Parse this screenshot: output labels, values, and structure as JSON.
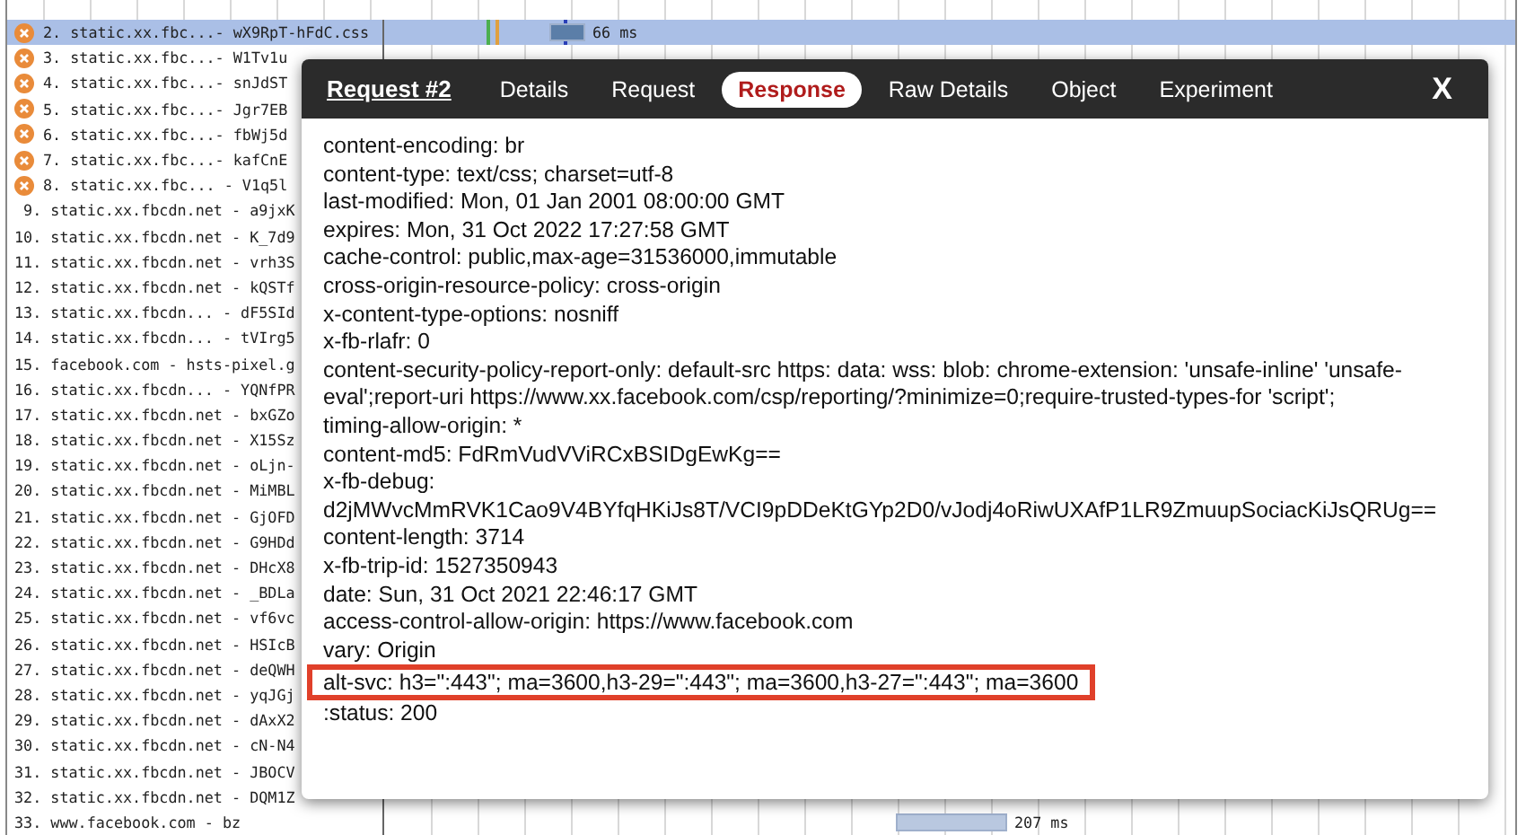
{
  "requests": [
    {
      "label": "2. static.xx.fbc...- wX9RpT-hFdC.css",
      "error": true,
      "selected": true,
      "timing": "66 ms"
    },
    {
      "label": "3. static.xx.fbc...- W1Tv1u",
      "error": true,
      "selected": false
    },
    {
      "label": "4. static.xx.fbc...- snJdST",
      "error": true,
      "selected": false
    },
    {
      "label": "5. static.xx.fbc...- Jgr7EB",
      "error": true,
      "selected": false
    },
    {
      "label": "6. static.xx.fbc...- fbWj5d",
      "error": true,
      "selected": false
    },
    {
      "label": "7. static.xx.fbc...- kafCnE",
      "error": true,
      "selected": false
    },
    {
      "label": "8. static.xx.fbc... - V1q5l",
      "error": true,
      "selected": false
    },
    {
      "label": " 9. static.xx.fbcdn.net - a9jxK",
      "error": false,
      "selected": false
    },
    {
      "label": "10. static.xx.fbcdn.net - K_7d9",
      "error": false,
      "selected": false
    },
    {
      "label": "11. static.xx.fbcdn.net - vrh3S",
      "error": false,
      "selected": false
    },
    {
      "label": "12. static.xx.fbcdn.net - kQSTf",
      "error": false,
      "selected": false
    },
    {
      "label": "13. static.xx.fbcdn... - dF5SId",
      "error": false,
      "selected": false
    },
    {
      "label": "14. static.xx.fbcdn... - tVIrg5",
      "error": false,
      "selected": false
    },
    {
      "label": "15. facebook.com - hsts-pixel.g",
      "error": false,
      "selected": false
    },
    {
      "label": "16. static.xx.fbcdn... - YQNfPR",
      "error": false,
      "selected": false
    },
    {
      "label": "17. static.xx.fbcdn.net - bxGZo",
      "error": false,
      "selected": false
    },
    {
      "label": "18. static.xx.fbcdn.net - X15Sz",
      "error": false,
      "selected": false
    },
    {
      "label": "19. static.xx.fbcdn.net - oLjn-",
      "error": false,
      "selected": false
    },
    {
      "label": "20. static.xx.fbcdn.net - MiMBL",
      "error": false,
      "selected": false
    },
    {
      "label": "21. static.xx.fbcdn.net - GjOFD",
      "error": false,
      "selected": false
    },
    {
      "label": "22. static.xx.fbcdn.net - G9HDd",
      "error": false,
      "selected": false
    },
    {
      "label": "23. static.xx.fbcdn.net - DHcX8",
      "error": false,
      "selected": false
    },
    {
      "label": "24. static.xx.fbcdn.net - _BDLa",
      "error": false,
      "selected": false
    },
    {
      "label": "25. static.xx.fbcdn.net - vf6vc",
      "error": false,
      "selected": false
    },
    {
      "label": "26. static.xx.fbcdn.net - HSIcB",
      "error": false,
      "selected": false
    },
    {
      "label": "27. static.xx.fbcdn.net - deQWH",
      "error": false,
      "selected": false
    },
    {
      "label": "28. static.xx.fbcdn.net - yqJGj",
      "error": false,
      "selected": false
    },
    {
      "label": "29. static.xx.fbcdn.net - dAxX2",
      "error": false,
      "selected": false
    },
    {
      "label": "30. static.xx.fbcdn.net - cN-N4",
      "error": false,
      "selected": false
    },
    {
      "label": "31. static.xx.fbcdn.net - JBOCV",
      "error": false,
      "selected": false
    },
    {
      "label": "32. static.xx.fbcdn.net - DQM1Z",
      "error": false,
      "selected": false
    },
    {
      "label": "33. www.facebook.com - bz",
      "error": false,
      "selected": false,
      "timing": "207 ms"
    }
  ],
  "dialog": {
    "title": "Request #2",
    "tabs": [
      {
        "label": "Details",
        "selected": false
      },
      {
        "label": "Request",
        "selected": false
      },
      {
        "label": "Response",
        "selected": true
      },
      {
        "label": "Raw Details",
        "selected": false
      },
      {
        "label": "Object",
        "selected": false
      },
      {
        "label": "Experiment",
        "selected": false
      }
    ],
    "close": "X",
    "headers": [
      {
        "text": "content-encoding: br",
        "highlighted": false
      },
      {
        "text": "content-type: text/css; charset=utf-8",
        "highlighted": false
      },
      {
        "text": "last-modified: Mon, 01 Jan 2001 08:00:00 GMT",
        "highlighted": false
      },
      {
        "text": "expires: Mon, 31 Oct 2022 17:27:58 GMT",
        "highlighted": false
      },
      {
        "text": "cache-control: public,max-age=31536000,immutable",
        "highlighted": false
      },
      {
        "text": "cross-origin-resource-policy: cross-origin",
        "highlighted": false
      },
      {
        "text": "x-content-type-options: nosniff",
        "highlighted": false
      },
      {
        "text": "x-fb-rlafr: 0",
        "highlighted": false
      },
      {
        "text": "content-security-policy-report-only: default-src https: data: wss: blob: chrome-extension: 'unsafe-inline' 'unsafe-eval';report-uri https://www.xx.facebook.com/csp/reporting/?minimize=0;require-trusted-types-for 'script';",
        "highlighted": false
      },
      {
        "text": "timing-allow-origin: *",
        "highlighted": false
      },
      {
        "text": "content-md5: FdRmVudVViRCxBSIDgEwKg==",
        "highlighted": false
      },
      {
        "text": "x-fb-debug: d2jMWvcMmRVK1Cao9V4BYfqHKiJs8T/VCI9pDDeKtGYp2D0/vJodj4oRiwUXAfP1LR9ZmuupSociacKiJsQRUg==",
        "highlighted": false
      },
      {
        "text": "content-length: 3714",
        "highlighted": false
      },
      {
        "text": "x-fb-trip-id: 1527350943",
        "highlighted": false
      },
      {
        "text": "date: Sun, 31 Oct 2021 22:46:17 GMT",
        "highlighted": false
      },
      {
        "text": "access-control-allow-origin: https://www.facebook.com",
        "highlighted": false
      },
      {
        "text": "vary: Origin",
        "highlighted": false
      },
      {
        "text": "alt-svc: h3=\":443\"; ma=3600,h3-29=\":443\"; ma=3600,h3-27=\":443\"; ma=3600",
        "highlighted": true
      },
      {
        "text": ":status: 200",
        "highlighted": false
      }
    ]
  }
}
